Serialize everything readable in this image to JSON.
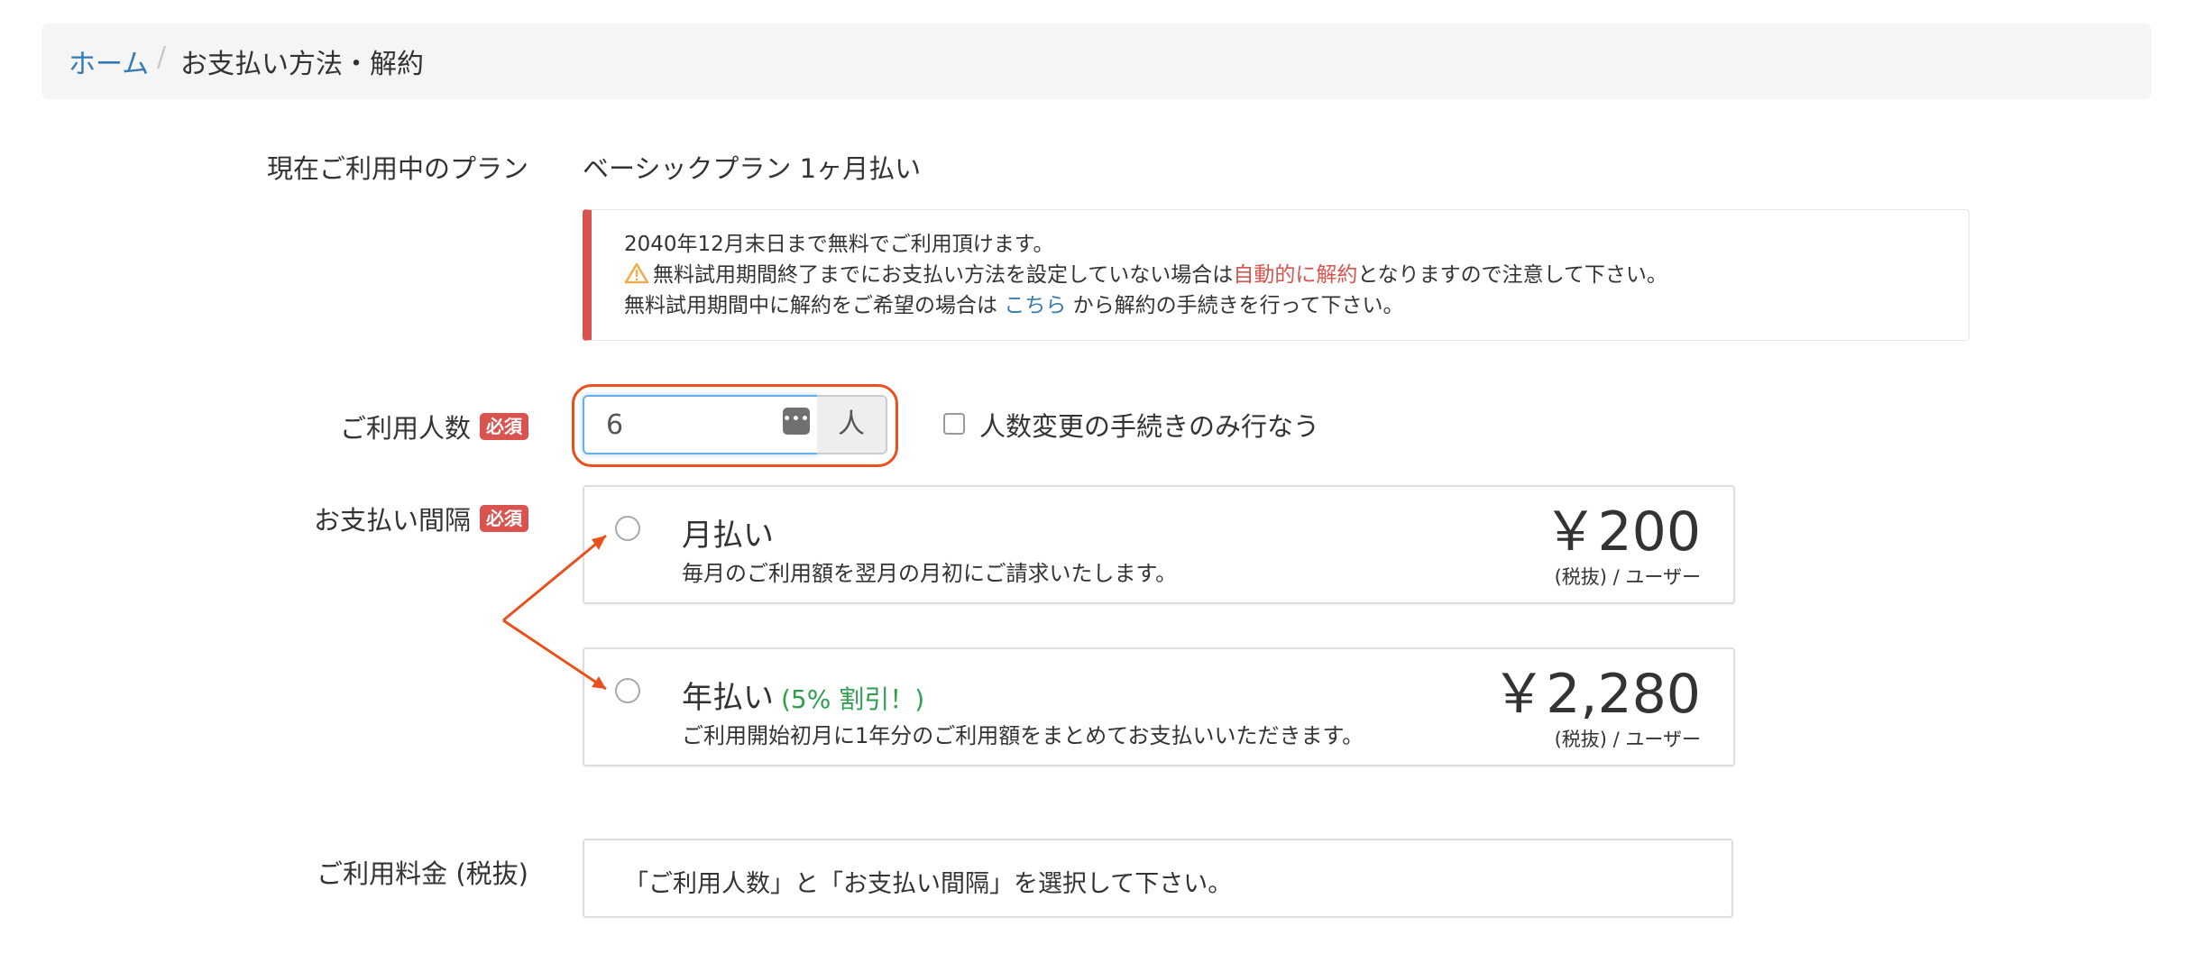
{
  "breadcrumb": {
    "home": "ホーム",
    "separator": "/",
    "current": "お支払い方法・解約"
  },
  "plan": {
    "label": "現在ご利用中のプラン",
    "value": "ベーシックプラン 1ヶ月払い"
  },
  "alert": {
    "line1": "2040年12月末日まで無料でご利用頂けます。",
    "line2_pre": "無料試用期間終了までにお支払い方法を設定していない場合は",
    "line2_red": "自動的に解約",
    "line2_post": "となりますので注意して下さい。",
    "line3_pre": "無料試用期間中に解約をご希望の場合は ",
    "line3_link": "こちら",
    "line3_post": " から解約の手続きを行って下さい。",
    "icon": "warning-triangle-icon"
  },
  "users": {
    "label": "ご利用人数",
    "required": "必須",
    "value": "6",
    "unit": "人",
    "checkbox_label": "人数変更の手続きのみ行なう",
    "checkbox_checked": false
  },
  "interval": {
    "label": "お支払い間隔",
    "required": "必須",
    "options": [
      {
        "title": "月払い",
        "discount": "",
        "description": "毎月のご利用額を翌月の月初にご請求いたします。",
        "price": "￥200",
        "unit": "(税抜) / ユーザー",
        "selected": false
      },
      {
        "title": "年払い",
        "discount": "(5% 割引！)",
        "description": "ご利用開始初月に1年分のご利用額をまとめてお支払いいただきます。",
        "price": "￥2,280",
        "unit": "(税抜) / ユーザー",
        "selected": false
      }
    ]
  },
  "fee": {
    "label": "ご利用料金 (税抜)",
    "message": "「ご利用人数」と「お支払い間隔」を選択して下さい。"
  },
  "colors": {
    "link": "#337ab7",
    "danger": "#d9534f",
    "annotation": "#e8501e",
    "discount": "#2e9e4e"
  }
}
